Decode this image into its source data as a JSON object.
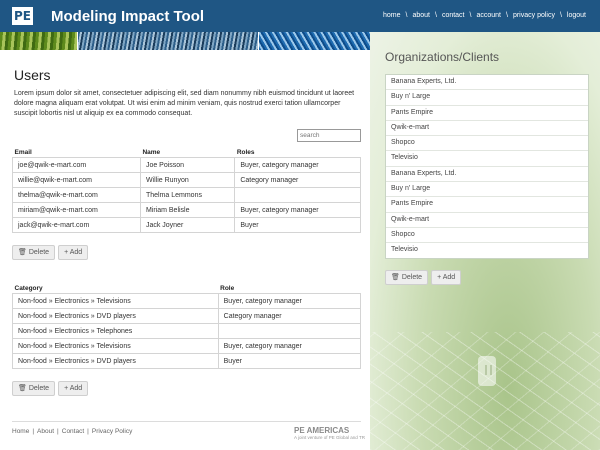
{
  "header": {
    "logo_text": "PE",
    "title": "Modeling Impact Tool",
    "nav": [
      {
        "label": "home"
      },
      {
        "label": "about"
      },
      {
        "label": "contact"
      },
      {
        "label": "account"
      },
      {
        "label": "privacy policy"
      },
      {
        "label": "logout"
      }
    ],
    "separator": "\\"
  },
  "users": {
    "title": "Users",
    "description": "Lorem ipsum dolor sit amet, consectetuer adipiscing elit, sed diam nonummy nibh euismod tincidunt ut laoreet dolore magna aliquam erat volutpat. Ut wisi enim ad minim veniam, quis nostrud exerci tation ullamcorper suscipit lobortis nisl ut aliquip ex ea commodo consequat.",
    "search_placeholder": "search",
    "columns": [
      "Email",
      "Name",
      "Roles"
    ],
    "rows": [
      [
        "joe@qwik-e-mart.com",
        "Joe Poisson",
        "Buyer, category manager"
      ],
      [
        "willie@qwik-e-mart.com",
        "Willie Runyon",
        "Category manager"
      ],
      [
        "thelma@qwik-e-mart.com",
        "Thelma Lemmons",
        ""
      ],
      [
        "miriam@qwik-e-mart.com",
        "Miriam Belisle",
        "Buyer, category manager"
      ],
      [
        "jack@qwik-e-mart.com",
        "Jack Joyner",
        "Buyer"
      ]
    ],
    "delete_label": "Delete",
    "add_label": "Add"
  },
  "categories": {
    "columns": [
      "Category",
      "Role"
    ],
    "rows": [
      [
        "Non-food » Electronics » Televisions",
        "Buyer, category manager"
      ],
      [
        "Non-food » Electronics » DVD players",
        "Category manager"
      ],
      [
        "Non-food » Electronics » Telephones",
        ""
      ],
      [
        "Non-food » Electronics » Televisions",
        "Buyer, category manager"
      ],
      [
        "Non-food » Electronics » DVD players",
        "Buyer"
      ]
    ],
    "delete_label": "Delete",
    "add_label": "Add"
  },
  "organizations": {
    "title": "Organizations/Clients",
    "items": [
      "Banana Experts, Ltd.",
      "Buy n' Large",
      "Pants Empire",
      "Qwik-e-mart",
      "Shopco",
      "Televisio",
      "Banana Experts, Ltd.",
      "Buy n' Large",
      "Pants Empire",
      "Qwik-e-mart",
      "Shopco",
      "Televisio"
    ],
    "delete_label": "Delete",
    "add_label": "Add"
  },
  "footer": {
    "links": [
      {
        "label": "Home"
      },
      {
        "label": "About"
      },
      {
        "label": "Contact"
      },
      {
        "label": "Privacy Policy"
      }
    ],
    "separator": "|",
    "brand_name": "PE AMERICAS",
    "brand_tagline": "A joint venture of PE Global and TR"
  },
  "colors": {
    "header_bg": "#1f5684",
    "panel_bg": "#e4eed8"
  },
  "icons": {
    "delete": "trash-icon",
    "add": "plus-icon"
  }
}
